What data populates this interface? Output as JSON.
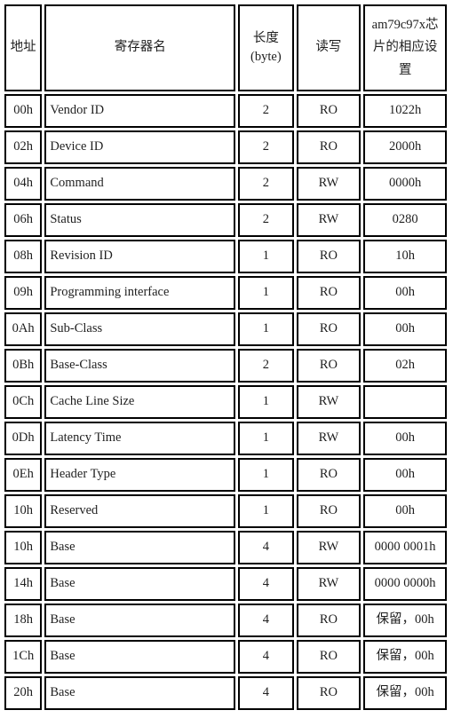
{
  "table": {
    "headers": {
      "address": "地址",
      "register_name": "寄存器名",
      "length_line1": "长度",
      "length_line2": "(byte)",
      "read_write": "读写",
      "chip_setting": "am79c97x芯片的相应设置"
    },
    "columns": [
      "地址",
      "寄存器名",
      "长度(byte)",
      "读写",
      "am79c97x芯片的相应设置"
    ],
    "rows": [
      {
        "address": "00h",
        "name": "Vendor ID",
        "length": "2",
        "rw": "RO",
        "setting": "1022h"
      },
      {
        "address": "02h",
        "name": "Device ID",
        "length": "2",
        "rw": "RO",
        "setting": "2000h"
      },
      {
        "address": "04h",
        "name": "Command",
        "length": "2",
        "rw": "RW",
        "setting": "0000h"
      },
      {
        "address": "06h",
        "name": "Status",
        "length": "2",
        "rw": "RW",
        "setting": "0280"
      },
      {
        "address": "08h",
        "name": "Revision ID",
        "length": "1",
        "rw": "RO",
        "setting": "10h"
      },
      {
        "address": "09h",
        "name": "Programming interface",
        "length": "1",
        "rw": "RO",
        "setting": "00h"
      },
      {
        "address": "0Ah",
        "name": "Sub-Class",
        "length": "1",
        "rw": "RO",
        "setting": "00h"
      },
      {
        "address": "0Bh",
        "name": "Base-Class",
        "length": "2",
        "rw": "RO",
        "setting": "02h"
      },
      {
        "address": "0Ch",
        "name": "Cache Line Size",
        "length": "1",
        "rw": "RW",
        "setting": ""
      },
      {
        "address": "0Dh",
        "name": "Latency Time",
        "length": "1",
        "rw": "RW",
        "setting": "00h"
      },
      {
        "address": "0Eh",
        "name": "Header Type",
        "length": "1",
        "rw": "RO",
        "setting": "00h"
      },
      {
        "address": "10h",
        "name": "Reserved",
        "length": "1",
        "rw": "RO",
        "setting": "00h"
      },
      {
        "address": "10h",
        "name": "Base",
        "length": "4",
        "rw": "RW",
        "setting": "0000 0001h"
      },
      {
        "address": "14h",
        "name": "Base",
        "length": "4",
        "rw": "RW",
        "setting": "0000 0000h"
      },
      {
        "address": "18h",
        "name": "Base",
        "length": "4",
        "rw": "RO",
        "setting": "保留，00h"
      },
      {
        "address": "1Ch",
        "name": "Base",
        "length": "4",
        "rw": "RO",
        "setting": "保留，00h"
      },
      {
        "address": "20h",
        "name": "Base",
        "length": "4",
        "rw": "RO",
        "setting": "保留，00h"
      }
    ]
  },
  "colors": {
    "border": "#000000",
    "text": "#1f1f1f",
    "background": "#ffffff"
  }
}
